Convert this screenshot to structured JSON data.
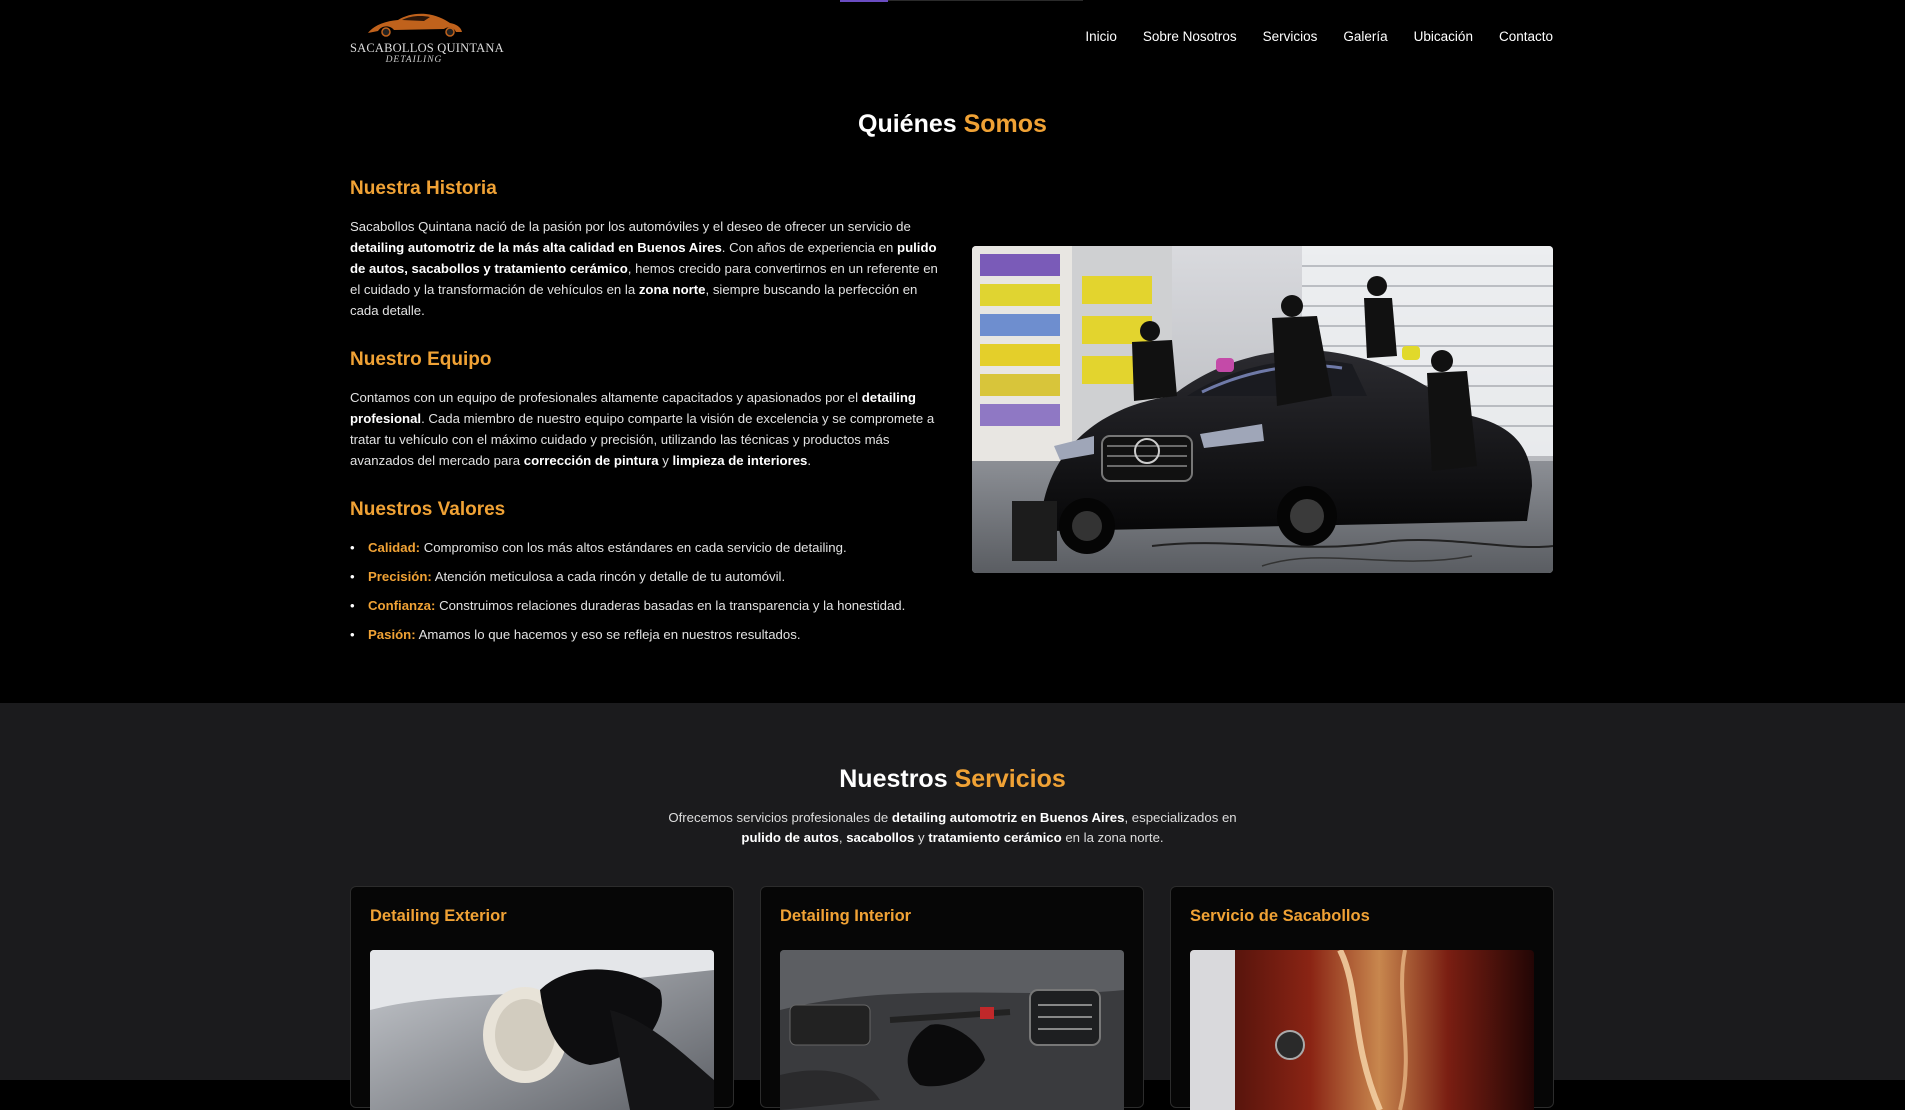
{
  "logo": {
    "brand": "SACABOLLOS QUINTANA",
    "sub": "DETAILING"
  },
  "nav": [
    "Inicio",
    "Sobre Nosotros",
    "Servicios",
    "Galería",
    "Ubicación",
    "Contacto"
  ],
  "about": {
    "title_a": "Quiénes ",
    "title_b": "Somos",
    "history_heading": "Nuestra Historia",
    "history": [
      {
        "t": "Sacabollos Quintana nació de la pasión por los automóviles y el deseo de ofrecer un servicio de ",
        "b": false
      },
      {
        "t": "detailing automotriz de la más alta calidad en Buenos Aires",
        "b": true
      },
      {
        "t": ". Con años de experiencia en ",
        "b": false
      },
      {
        "t": "pulido de autos, sacabollos y tratamiento cerámico",
        "b": true
      },
      {
        "t": ", hemos crecido para convertirnos en un referente en el cuidado y la transformación de vehículos en la ",
        "b": false
      },
      {
        "t": "zona norte",
        "b": true
      },
      {
        "t": ", siempre buscando la perfección en cada detalle.",
        "b": false
      }
    ],
    "team_heading": "Nuestro Equipo",
    "team": [
      {
        "t": "Contamos con un equipo de profesionales altamente capacitados y apasionados por el ",
        "b": false
      },
      {
        "t": "detailing profesional",
        "b": true
      },
      {
        "t": ". Cada miembro de nuestro equipo comparte la visión de excelencia y se compromete a tratar tu vehículo con el máximo cuidado y precisión, utilizando las técnicas y productos más avanzados del mercado para ",
        "b": false
      },
      {
        "t": "corrección de pintura",
        "b": true
      },
      {
        "t": " y ",
        "b": false
      },
      {
        "t": "limpieza de interiores",
        "b": true
      },
      {
        "t": ".",
        "b": false
      }
    ],
    "values_heading": "Nuestros Valores",
    "values": [
      {
        "key": "Calidad:",
        "text": " Compromiso con los más altos estándares en cada servicio de detailing."
      },
      {
        "key": "Precisión:",
        "text": " Atención meticulosa a cada rincón y detalle de tu automóvil."
      },
      {
        "key": "Confianza:",
        "text": " Construimos relaciones duraderas basadas en la transparencia y la honestidad."
      },
      {
        "key": "Pasión:",
        "text": " Amamos lo que hacemos y eso se refleja en nuestros resultados."
      }
    ]
  },
  "services": {
    "title_a": "Nuestros ",
    "title_b": "Servicios",
    "desc_line1": [
      {
        "t": "Ofrecemos servicios profesionales de ",
        "b": false
      },
      {
        "t": "detailing automotriz en Buenos Aires",
        "b": true
      },
      {
        "t": ", especializados en",
        "b": false
      }
    ],
    "desc_line2": [
      {
        "t": "pulido de autos",
        "b": true
      },
      {
        "t": ", ",
        "b": false
      },
      {
        "t": "sacabollos",
        "b": true
      },
      {
        "t": " y ",
        "b": false
      },
      {
        "t": "tratamiento cerámico",
        "b": true
      },
      {
        "t": " en la zona norte.",
        "b": false
      }
    ],
    "cards": [
      "Detailing Exterior",
      "Detailing Interior",
      "Servicio de Sacabollos"
    ]
  },
  "colors": {
    "accent": "#f0a235",
    "bg": "#000000",
    "section_bg": "#1b1b1d"
  }
}
